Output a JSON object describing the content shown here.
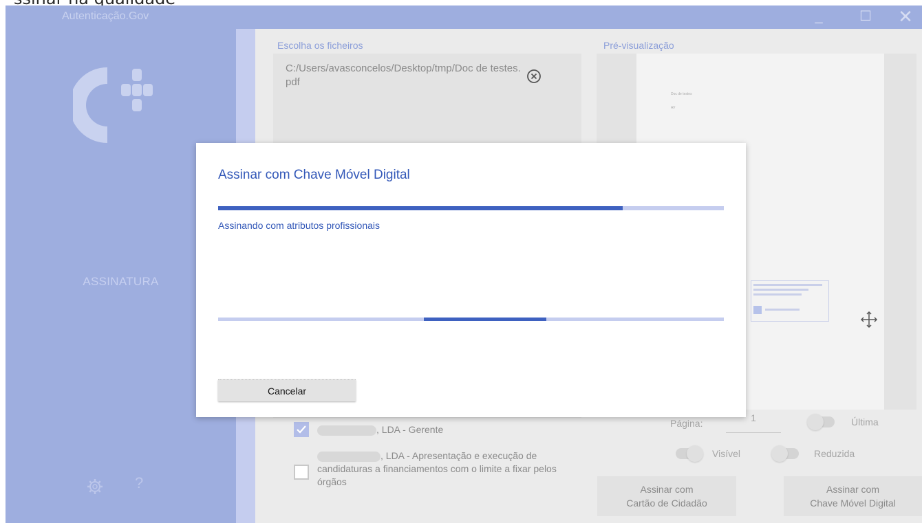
{
  "top_fragment": "ssinar na qualidade",
  "window": {
    "title": "Autenticação.Gov",
    "minimize": "_",
    "maximize": "☐",
    "close": "✕"
  },
  "sidebar": {
    "section": "ASSINATURA",
    "help": "?"
  },
  "files": {
    "label": "Escolha os ficheiros",
    "path": "C:/Users/avasconcelos/Desktop/tmp/Doc de testes.pdf"
  },
  "preview": {
    "label": "Pré-visualização",
    "page_line1": "Doc de testes",
    "page_line2": "AV"
  },
  "attributes": [
    {
      "text": ", LDA - Gerente",
      "checked": true
    },
    {
      "text": ", LDA - Apresentação e execução de candidaturas a financiamentos com o limite a fixar pelos órgãos",
      "checked": false
    }
  ],
  "options": {
    "page_label": "Página:",
    "page_value": "1",
    "last": "Última",
    "visible": "Visível",
    "reduced": "Reduzida"
  },
  "buttons": {
    "sign_cc_line1": "Assinar com",
    "sign_cc_line2": "Cartão de Cidadão",
    "sign_cmd_line1": "Assinar com",
    "sign_cmd_line2": "Chave Móvel Digital"
  },
  "dialog": {
    "title": "Assinar com Chave Móvel Digital",
    "progress_fraction": 0.8,
    "status": "Assinando com atributos profissionais",
    "cancel": "Cancelar"
  },
  "colors": {
    "accent": "#3358b8",
    "sidebar": "#9eaedf",
    "progress": "#3e61c0"
  }
}
